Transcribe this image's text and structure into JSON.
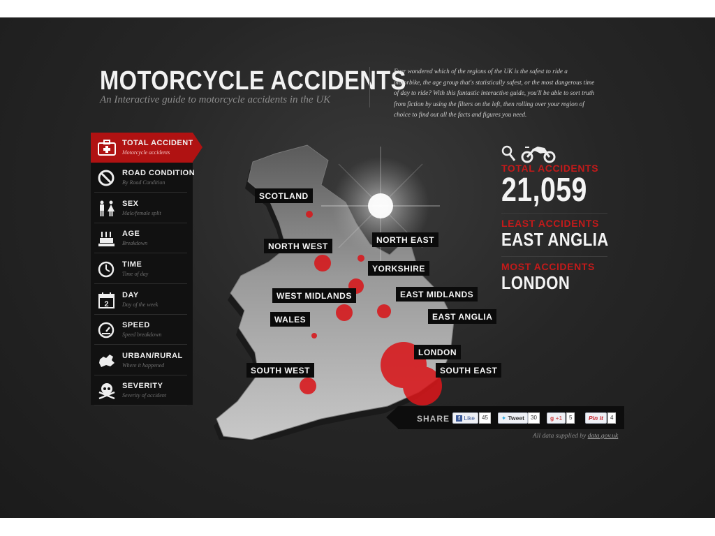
{
  "header": {
    "title": "MOTORCYCLE ACCIDENTS",
    "subtitle": "An Interactive guide to motorcycle accidents in the UK",
    "intro": "Ever wondered which of the regions of the UK is the safest to ride a motorbike, the age group that's statistically safest, or the most dangerous time of day to ride? With this fantastic interactive guide, you'll be able to sort truth from fiction by using the filters on the left, then rolling over your region of choice to find out all the facts and figures you need."
  },
  "menu": [
    {
      "label": "TOTAL ACCIDENTS",
      "sub": "Motorcycle accidents",
      "icon": "first-aid-icon",
      "active": true
    },
    {
      "label": "ROAD CONDITION",
      "sub": "By Road Condition",
      "icon": "no-entry-icon"
    },
    {
      "label": "SEX",
      "sub": "Male/female split",
      "icon": "male-female-icon"
    },
    {
      "label": "AGE",
      "sub": "Breakdown",
      "icon": "birthday-cake-icon"
    },
    {
      "label": "TIME",
      "sub": "Time of day",
      "icon": "clock-icon"
    },
    {
      "label": "DAY",
      "sub": "Day of the week",
      "icon": "calendar-icon",
      "day_number": "2"
    },
    {
      "label": "SPEED",
      "sub": "Speed breakdown",
      "icon": "speedometer-icon"
    },
    {
      "label": "URBAN/RURAL",
      "sub": "Where it happened",
      "icon": "city-shape-icon"
    },
    {
      "label": "SEVERITY",
      "sub": "Severity of accident",
      "icon": "skull-crossbones-icon"
    }
  ],
  "map": {
    "regions": [
      "SCOTLAND",
      "NORTH WEST",
      "NORTH EAST",
      "YORKSHIRE",
      "WEST MIDLANDS",
      "EAST MIDLANDS",
      "WALES",
      "EAST ANGLIA",
      "LONDON",
      "SOUTH WEST",
      "SOUTH EAST"
    ]
  },
  "stats": {
    "total_label": "TOTAL ACCIDENTS",
    "total_value": "21,059",
    "least_label": "LEAST ACCIDENTS",
    "least_value": "EAST ANGLIA",
    "most_label": "MOST ACCIDENTS",
    "most_value": "LONDON"
  },
  "share": {
    "label": "SHARE",
    "facebook_label": "Like",
    "facebook_count": "45",
    "twitter_label": "Tweet",
    "twitter_count": "30",
    "gplus_label": "+1",
    "gplus_count": "5",
    "pinterest_label": "Pin it",
    "pinterest_count": "4"
  },
  "credit": {
    "text": "All data supplied by",
    "link": "data.gov.uk"
  },
  "colors": {
    "accent": "#b01212",
    "marker": "#d8171b",
    "background": "#222222"
  }
}
